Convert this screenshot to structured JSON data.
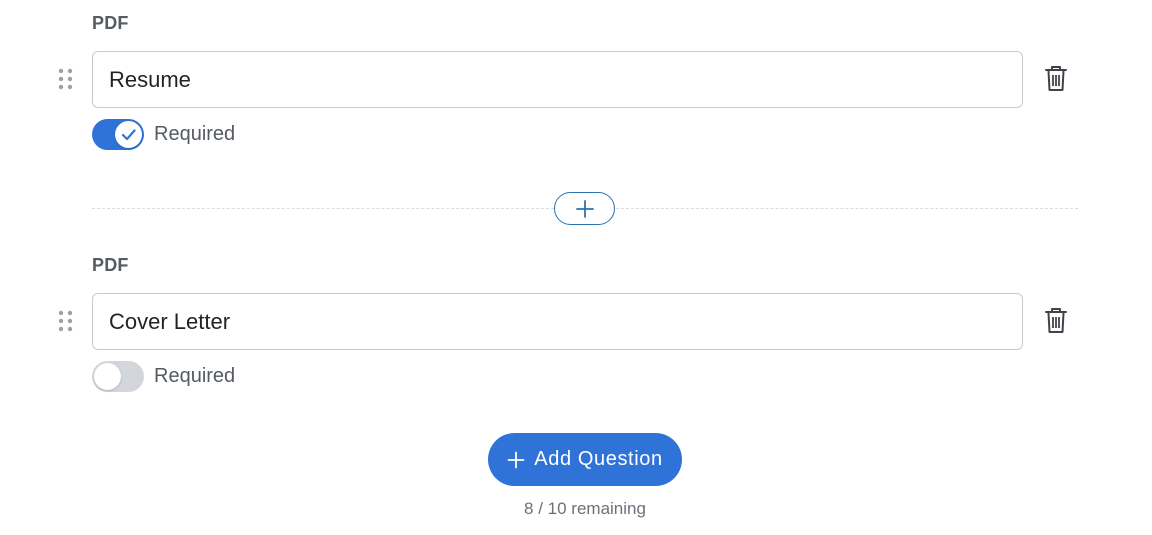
{
  "questions": [
    {
      "type_label": "PDF",
      "value": "Resume",
      "required_label": "Required",
      "required": true
    },
    {
      "type_label": "PDF",
      "value": "Cover Letter",
      "required_label": "Required",
      "required": false
    }
  ],
  "add_button": {
    "label": "Add Question",
    "icon": "plus-icon"
  },
  "insert_button": {
    "icon": "plus-icon"
  },
  "remaining": {
    "text": "8 / 10 remaining"
  },
  "icons": {
    "drag": "drag-handle-icon",
    "delete": "trash-icon",
    "check": "check-icon"
  },
  "colors": {
    "accent": "#2f73d9",
    "toggle_off": "#d3d6da",
    "insert_border": "#2a72ad",
    "muted_text": "#555b62"
  }
}
